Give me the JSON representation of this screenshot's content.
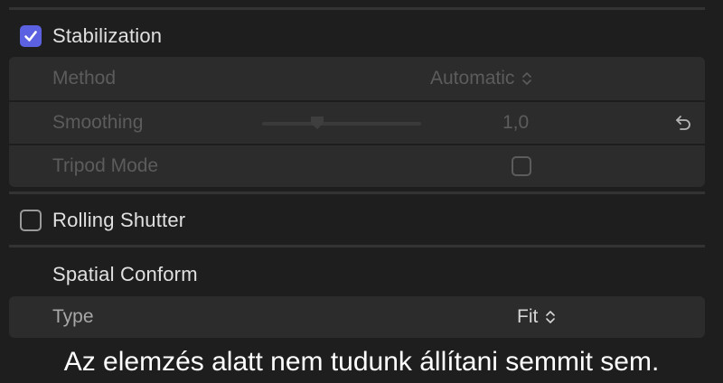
{
  "stabilization": {
    "label": "Stabilization",
    "checked": true,
    "method": {
      "label": "Method",
      "value": "Automatic"
    },
    "smoothing": {
      "label": "Smoothing",
      "value": "1,0",
      "level": 0.33
    },
    "tripod_mode": {
      "label": "Tripod Mode",
      "checked": false
    }
  },
  "rolling_shutter": {
    "label": "Rolling Shutter",
    "checked": false
  },
  "spatial_conform": {
    "heading": "Spatial Conform",
    "type": {
      "label": "Type",
      "value": "Fit"
    }
  },
  "caption": "Az elemzés alatt nem tudunk állítani semmit sem.",
  "colors": {
    "accent": "#5b61e0",
    "background": "#1e1e1e",
    "panel": "#2c2c2c",
    "disabled_text": "#5c5c5c"
  },
  "icons": [
    "checkmark-icon",
    "updown-chevron-icon",
    "slider-thumb-icon",
    "reset-icon"
  ]
}
